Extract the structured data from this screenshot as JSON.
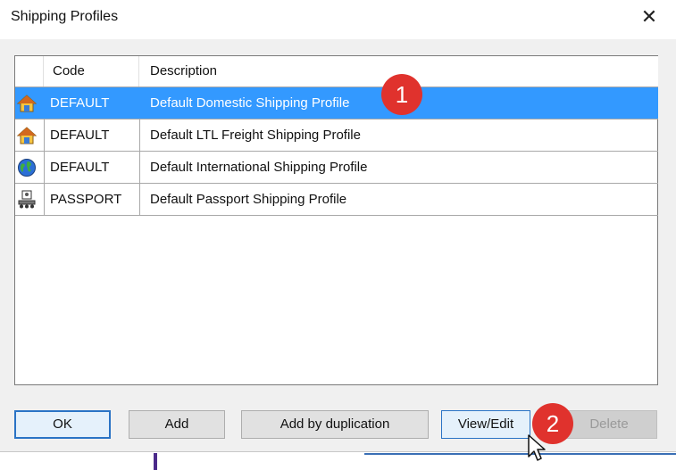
{
  "window": {
    "title": "Shipping Profiles",
    "close_glyph": "✕"
  },
  "list": {
    "columns": [
      "Code",
      "Description"
    ],
    "rows": [
      {
        "icon": "house-icon",
        "code": "DEFAULT",
        "description": "Default Domestic Shipping Profile",
        "selected": true
      },
      {
        "icon": "house-icon",
        "code": "DEFAULT",
        "description": "Default LTL Freight Shipping Profile",
        "selected": false
      },
      {
        "icon": "globe-icon",
        "code": "DEFAULT",
        "description": "Default International Shipping Profile",
        "selected": false
      },
      {
        "icon": "passport-icon",
        "code": "PASSPORT",
        "description": "Default Passport Shipping Profile",
        "selected": false
      }
    ]
  },
  "buttons": {
    "ok": "OK",
    "add": "Add",
    "add_dup": "Add by duplication",
    "view_edit": "View/Edit",
    "delete": "Delete"
  },
  "annotations": {
    "badge1": "1",
    "badge2": "2"
  },
  "colors": {
    "selection": "#3399ff",
    "badge": "#e0322d",
    "default_button_border": "#2a73c5"
  }
}
